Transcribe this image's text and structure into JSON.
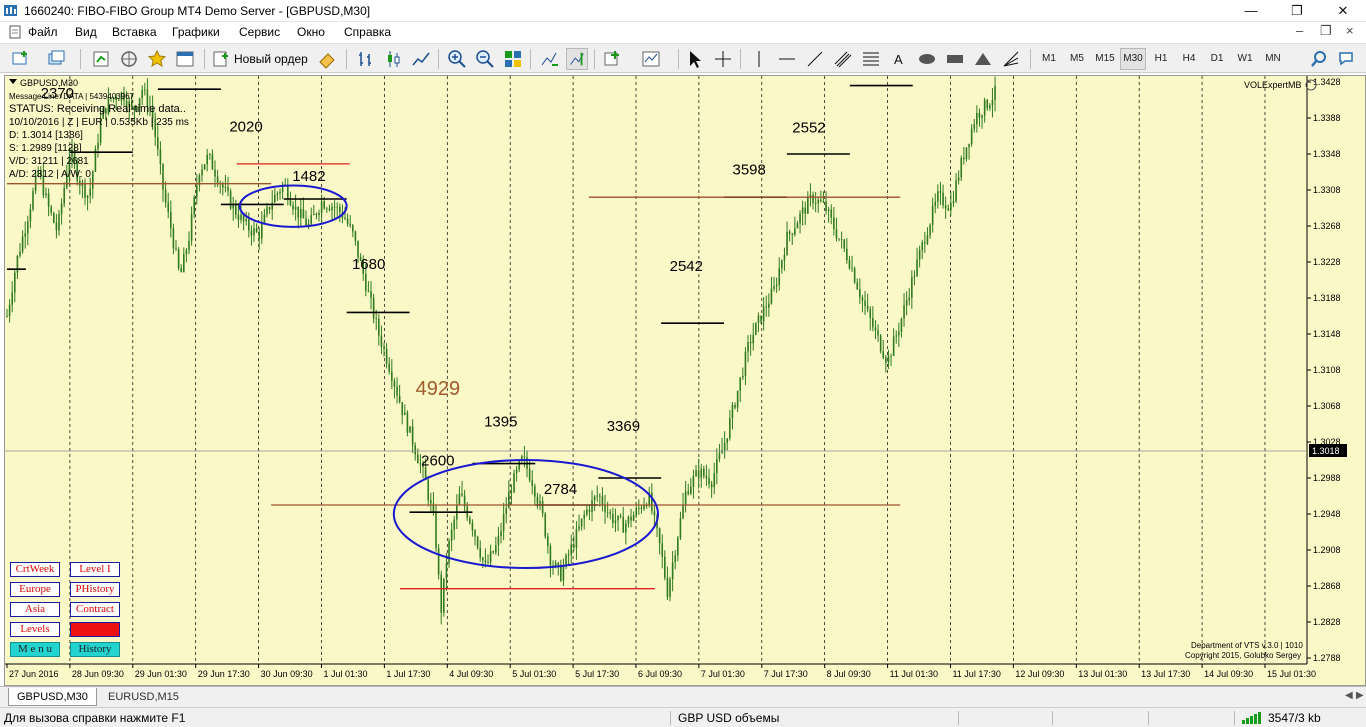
{
  "window": {
    "title": "1660240: FIBO-FIBO Group MT4 Demo Server - [GBPUSD,M30]"
  },
  "menu": [
    "Файл",
    "Вид",
    "Вставка",
    "Графики",
    "Сервис",
    "Окно",
    "Справка"
  ],
  "toolbar": {
    "new_order_label": "Новый ордер",
    "timeframes": [
      "M1",
      "M5",
      "M15",
      "M30",
      "H1",
      "H4",
      "D1",
      "W1",
      "MN"
    ],
    "active_timeframe": "M30"
  },
  "chart_info": {
    "symbol_label": "GBPUSD,M30",
    "lines": [
      "Message Line: DATA | 5439403967",
      "STATUS:  Receiving Real-time data..",
      "10/10/2016 | Z | EUR | 0.535Kb | 235 ms",
      "D: 1.3014  [1386]",
      "S: 1.2989  [1128]",
      "V/D: 31211 | 2681",
      "A/D: 2312 | A/W: 0"
    ],
    "indicator_label": "VOLExpertMB",
    "credits": [
      "Department of VTS  v.3.0 | 1010",
      "Copyright 2015, Golubko Sergey"
    ]
  },
  "side_buttons": [
    [
      "CrtWeek",
      "Level I"
    ],
    [
      "Europe",
      "PHistory"
    ],
    [
      "Asia",
      "Contract"
    ],
    [
      "Levels",
      ""
    ],
    [
      "M e n u",
      "History"
    ]
  ],
  "tabs": [
    "GBPUSD,M30",
    "EURUSD,M15"
  ],
  "active_tab": "GBPUSD,M30",
  "status": {
    "help": "Для вызова справки нажмите F1",
    "profile": "GBP USD объемы",
    "traffic": "3547/3 kb"
  },
  "chart_data": {
    "type": "candlestick",
    "symbol": "GBPUSD",
    "timeframe": "M30",
    "ylim": [
      1.2788,
      1.3428
    ],
    "y_ticks": [
      1.3428,
      1.3388,
      1.3348,
      1.3308,
      1.3268,
      1.3228,
      1.3188,
      1.3148,
      1.3108,
      1.3068,
      1.3028,
      1.2988,
      1.2948,
      1.2908,
      1.2868,
      1.2828,
      1.2788
    ],
    "current_price": 1.3018,
    "x_labels": [
      "27 Jun 2016",
      "28 Jun 09:30",
      "29 Jun 01:30",
      "29 Jun 17:30",
      "30 Jun 09:30",
      "1 Jul 01:30",
      "1 Jul 17:30",
      "4 Jul 09:30",
      "5 Jul 01:30",
      "5 Jul 17:30",
      "6 Jul 09:30",
      "7 Jul 01:30",
      "7 Jul 17:30",
      "8 Jul 09:30",
      "11 Jul 01:30",
      "11 Jul 17:30",
      "12 Jul 09:30",
      "13 Jul 01:30",
      "13 Jul 17:30",
      "14 Jul 09:30",
      "15 Jul 01:30"
    ],
    "price_path": [
      [
        0,
        1.3168
      ],
      [
        0.3,
        1.3228
      ],
      [
        0.6,
        1.327
      ],
      [
        1.0,
        1.333
      ],
      [
        1.3,
        1.329
      ],
      [
        1.6,
        1.3262
      ],
      [
        2.0,
        1.3352
      ],
      [
        2.3,
        1.3318
      ],
      [
        2.6,
        1.33
      ],
      [
        3.0,
        1.339
      ],
      [
        3.3,
        1.341
      ],
      [
        3.7,
        1.3415
      ],
      [
        4.0,
        1.3395
      ],
      [
        4.3,
        1.342
      ],
      [
        4.6,
        1.3395
      ],
      [
        5.0,
        1.33
      ],
      [
        5.2,
        1.3268
      ],
      [
        5.5,
        1.321
      ],
      [
        5.8,
        1.3258
      ],
      [
        6.1,
        1.333
      ],
      [
        6.4,
        1.3345
      ],
      [
        6.8,
        1.3315
      ],
      [
        7.2,
        1.3288
      ],
      [
        7.6,
        1.3268
      ],
      [
        8.0,
        1.3258
      ],
      [
        8.4,
        1.3295
      ],
      [
        8.8,
        1.3315
      ],
      [
        9.2,
        1.3285
      ],
      [
        9.6,
        1.3268
      ],
      [
        10.0,
        1.3295
      ],
      [
        10.4,
        1.329
      ],
      [
        10.7,
        1.328
      ],
      [
        11.0,
        1.3258
      ],
      [
        11.4,
        1.3205
      ],
      [
        11.8,
        1.315
      ],
      [
        12.2,
        1.3108
      ],
      [
        12.6,
        1.306
      ],
      [
        13.0,
        1.3018
      ],
      [
        13.3,
        1.2985
      ],
      [
        13.6,
        1.2935
      ],
      [
        13.8,
        1.284
      ],
      [
        14.0,
        1.2905
      ],
      [
        14.4,
        1.297
      ],
      [
        14.8,
        1.2935
      ],
      [
        15.2,
        1.2888
      ],
      [
        15.6,
        1.2915
      ],
      [
        16.0,
        1.2975
      ],
      [
        16.4,
        1.301
      ],
      [
        16.7,
        1.2985
      ],
      [
        17.0,
        1.295
      ],
      [
        17.3,
        1.2895
      ],
      [
        17.6,
        1.288
      ],
      [
        18.0,
        1.2915
      ],
      [
        18.4,
        1.295
      ],
      [
        18.8,
        1.297
      ],
      [
        19.2,
        1.2945
      ],
      [
        19.6,
        1.2935
      ],
      [
        20.0,
        1.295
      ],
      [
        20.4,
        1.2968
      ],
      [
        20.8,
        1.2905
      ],
      [
        21.0,
        1.2862
      ],
      [
        21.3,
        1.292
      ],
      [
        21.6,
        1.2975
      ],
      [
        22.0,
        1.2995
      ],
      [
        22.4,
        1.2985
      ],
      [
        22.8,
        1.3025
      ],
      [
        23.2,
        1.308
      ],
      [
        23.6,
        1.3138
      ],
      [
        24.0,
        1.317
      ],
      [
        24.4,
        1.3198
      ],
      [
        24.8,
        1.3255
      ],
      [
        25.2,
        1.3278
      ],
      [
        25.6,
        1.33
      ],
      [
        26.0,
        1.329
      ],
      [
        26.4,
        1.3258
      ],
      [
        26.8,
        1.3228
      ],
      [
        27.2,
        1.3185
      ],
      [
        27.6,
        1.315
      ],
      [
        28.0,
        1.3118
      ],
      [
        28.4,
        1.316
      ],
      [
        28.8,
        1.321
      ],
      [
        29.2,
        1.3258
      ],
      [
        29.6,
        1.33
      ],
      [
        30.0,
        1.329
      ],
      [
        30.4,
        1.3345
      ],
      [
        30.8,
        1.339
      ],
      [
        31.2,
        1.3405
      ],
      [
        31.5,
        1.342
      ]
    ],
    "levels": [
      {
        "kind": "session",
        "x1": 0,
        "x2": 0.6,
        "y": 1.322
      },
      {
        "kind": "session",
        "x1": 2.0,
        "x2": 4.0,
        "y": 1.335
      },
      {
        "kind": "session",
        "x1": 4.8,
        "x2": 6.8,
        "y": 1.342
      },
      {
        "kind": "session",
        "x1": 6.8,
        "x2": 8.8,
        "y": 1.3292
      },
      {
        "kind": "session",
        "x1": 8.8,
        "x2": 10.8,
        "y": 1.3298
      },
      {
        "kind": "session",
        "x1": 10.8,
        "x2": 12.8,
        "y": 1.3172
      },
      {
        "kind": "session",
        "x1": 12.8,
        "x2": 14.8,
        "y": 1.295
      },
      {
        "kind": "session",
        "x1": 14.8,
        "x2": 16.8,
        "y": 1.3004
      },
      {
        "kind": "session",
        "x1": 16.8,
        "x2": 18.8,
        "y": 1.2958
      },
      {
        "kind": "session",
        "x1": 18.8,
        "x2": 20.8,
        "y": 1.2988
      },
      {
        "kind": "session",
        "x1": 20.8,
        "x2": 22.8,
        "y": 1.316
      },
      {
        "kind": "session",
        "x1": 22.8,
        "x2": 24.8,
        "y": 1.33
      },
      {
        "kind": "session",
        "x1": 24.8,
        "x2": 26.8,
        "y": 1.3348
      },
      {
        "kind": "session",
        "x1": 26.8,
        "x2": 28.8,
        "y": 1.3424
      },
      {
        "kind": "red",
        "x1": 7.3,
        "x2": 10.9,
        "y": 1.3337
      },
      {
        "kind": "red",
        "x1": 12.5,
        "x2": 20.6,
        "y": 1.2865
      },
      {
        "kind": "brown",
        "x1": 0,
        "x2": 8.4,
        "y": 1.3315
      },
      {
        "kind": "brown",
        "x1": 8.4,
        "x2": 28.4,
        "y": 1.2958
      },
      {
        "kind": "brown",
        "x1": 18.5,
        "x2": 28.4,
        "y": 1.33
      }
    ],
    "ellipses": [
      {
        "cx": 9.1,
        "cy": 1.329,
        "rx": 1.7,
        "ry": 0.0023
      },
      {
        "cx": 16.5,
        "cy": 1.2948,
        "rx": 4.2,
        "ry": 0.006
      }
    ],
    "volume_labels": [
      {
        "text": "2370",
        "x": 1.6,
        "y": 1.341,
        "color": "#000"
      },
      {
        "text": "2020",
        "x": 7.6,
        "y": 1.3373,
        "color": "#000"
      },
      {
        "text": "1482",
        "x": 9.6,
        "y": 1.3318,
        "color": "#000"
      },
      {
        "text": "1680",
        "x": 11.5,
        "y": 1.322,
        "color": "#000"
      },
      {
        "text": "4929",
        "x": 13.7,
        "y": 1.308,
        "color": "#a05a2c"
      },
      {
        "text": "1395",
        "x": 15.7,
        "y": 1.3045,
        "color": "#000"
      },
      {
        "text": "2600",
        "x": 13.7,
        "y": 1.3002,
        "color": "#000"
      },
      {
        "text": "2784",
        "x": 17.6,
        "y": 1.297,
        "color": "#000"
      },
      {
        "text": "3369",
        "x": 19.6,
        "y": 1.304,
        "color": "#000"
      },
      {
        "text": "2542",
        "x": 21.6,
        "y": 1.3218,
        "color": "#000"
      },
      {
        "text": "3598",
        "x": 23.6,
        "y": 1.3325,
        "color": "#000"
      },
      {
        "text": "2552",
        "x": 25.5,
        "y": 1.3372,
        "color": "#000"
      }
    ],
    "colors": {
      "background": "#fbf8c8",
      "candle": "#2f7a1f",
      "session_level": "#000000",
      "red_level": "#e02020",
      "brown_level": "#a0522d",
      "ellipse": "#1a1ad0"
    }
  }
}
